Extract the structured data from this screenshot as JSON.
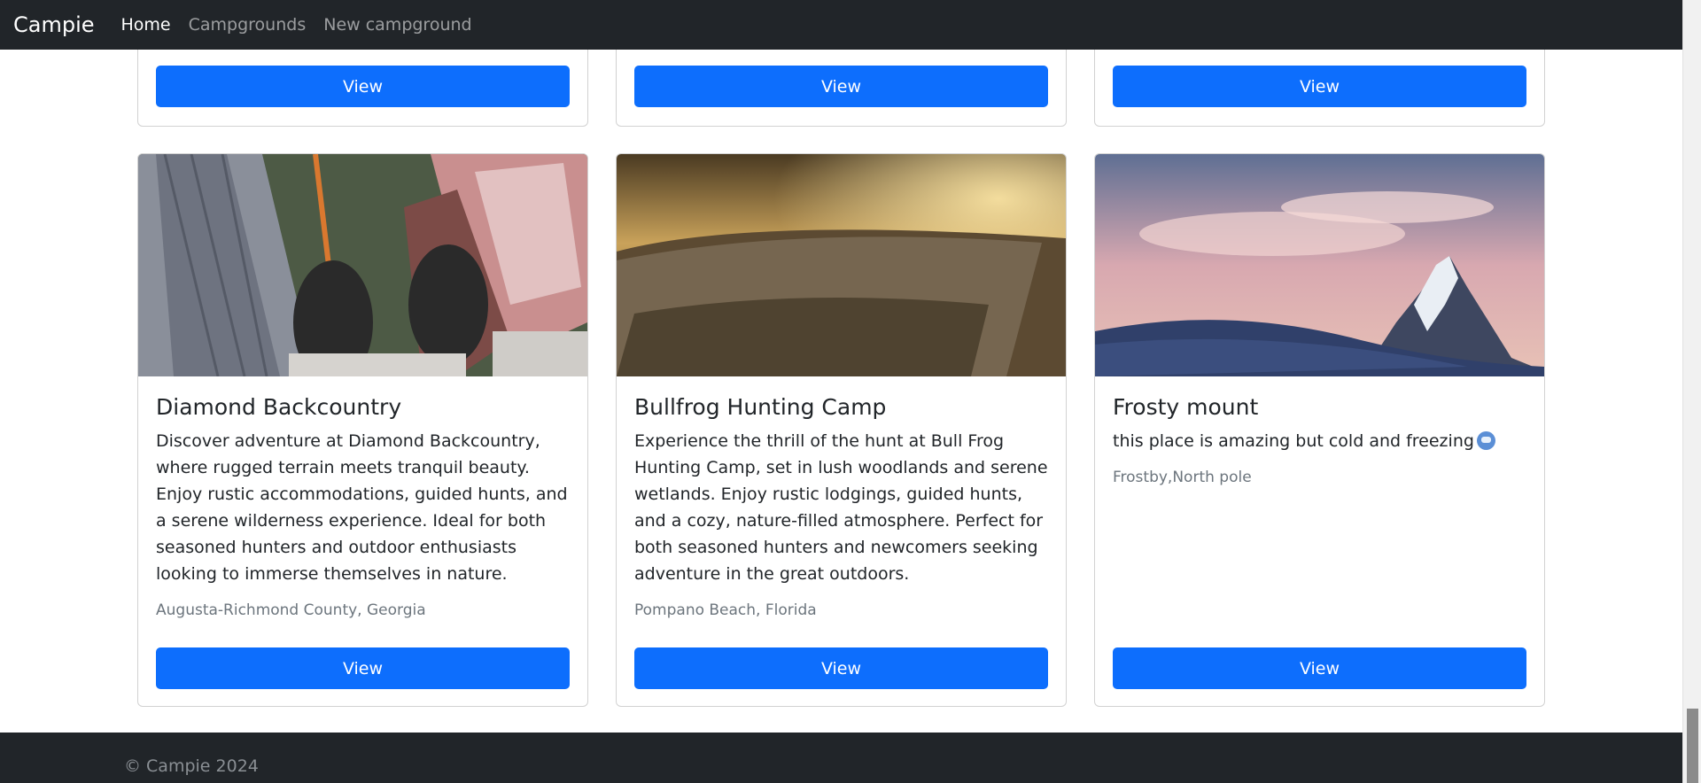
{
  "navbar": {
    "brand": "Campie",
    "links": [
      {
        "label": "Home",
        "active": true
      },
      {
        "label": "Campgrounds",
        "active": false
      },
      {
        "label": "New campground",
        "active": false
      }
    ]
  },
  "top_cards": [
    {
      "button": "View"
    },
    {
      "button": "View"
    },
    {
      "button": "View"
    }
  ],
  "cards": [
    {
      "title": "Diamond Backcountry",
      "description": "Discover adventure at Diamond Backcountry, where rugged terrain meets tranquil beauty. Enjoy rustic accommodations, guided hunts, and a serene wilderness experience. Ideal for both seasoned hunters and outdoor enthusiasts looking to immerse themselves in nature.",
      "location": "Augusta-Richmond County, Georgia",
      "button": "View",
      "image": "city-rooftop-feet-photo"
    },
    {
      "title": "Bullfrog Hunting Camp",
      "description": "Experience the thrill of the hunt at Bull Frog Hunting Camp, set in lush woodlands and serene wetlands. Enjoy rustic lodgings, guided hunts, and a cozy, nature-filled atmosphere. Perfect for both seasoned hunters and newcomers seeking adventure in the great outdoors.",
      "location": "Pompano Beach, Florida",
      "button": "View",
      "image": "tree-stump-sunset-photo"
    },
    {
      "title": "Frosty mount",
      "description": "this place is amazing but cold and freezing",
      "location": "Frostby,North pole",
      "button": "View",
      "image": "snowy-mountain-photo"
    }
  ],
  "footer": {
    "text": "© Campie 2024"
  },
  "colors": {
    "navbar_bg": "#212529",
    "primary": "#0d6efd",
    "muted": "#6c757d"
  }
}
